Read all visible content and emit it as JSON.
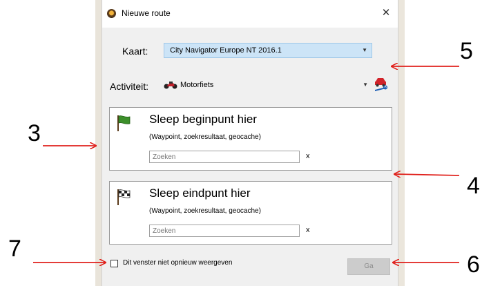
{
  "window": {
    "title": "Nieuwe route",
    "close_glyph": "✕"
  },
  "map_field": {
    "label": "Kaart:",
    "value": "City Navigator Europe NT 2016.1"
  },
  "activity_field": {
    "label": "Activiteit:",
    "value": "Motorfiets",
    "icon": "motorcycle-icon",
    "settings_icon": "vehicle-settings-icon"
  },
  "start_box": {
    "title": "Sleep beginpunt hier",
    "subtitle": "(Waypoint, zoekresultaat, geocache)",
    "search_placeholder": "Zoeken",
    "clear": "x",
    "flag_color": "#3c8f2a"
  },
  "end_box": {
    "title": "Sleep eindpunt hier",
    "subtitle": "(Waypoint, zoekresultaat, geocache)",
    "search_placeholder": "Zoeken",
    "clear": "x"
  },
  "footer": {
    "checkbox_label": "Dit venster niet opnieuw weergeven",
    "checkbox_checked": false,
    "go_label": "Ga"
  },
  "annotations": {
    "n3": "3",
    "n4": "4",
    "n5": "5",
    "n6": "6",
    "n7": "7",
    "arrow_color": "#e0201b"
  }
}
